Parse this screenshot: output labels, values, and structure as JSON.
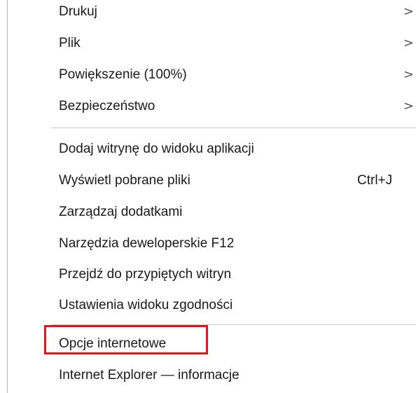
{
  "menu": {
    "items_top": [
      {
        "label": "Drukuj",
        "submenu": true
      },
      {
        "label": "Plik",
        "submenu": true
      },
      {
        "label": "Powiększenie (100%)",
        "submenu": true
      },
      {
        "label": "Bezpieczeństwo",
        "submenu": true
      }
    ],
    "items_mid": [
      {
        "label": "Dodaj witrynę do widoku aplikacji",
        "shortcut": ""
      },
      {
        "label": "Wyświetl pobrane pliki",
        "shortcut": "Ctrl+J"
      },
      {
        "label": "Zarządzaj dodatkami",
        "shortcut": ""
      },
      {
        "label": "Narzędzia deweloperskie F12",
        "shortcut": ""
      },
      {
        "label": "Przejdź do przypiętych witryn",
        "shortcut": ""
      },
      {
        "label": "Ustawienia widoku zgodności",
        "shortcut": ""
      }
    ],
    "items_bottom": [
      {
        "label": "Opcje internetowe",
        "highlighted": true
      },
      {
        "label": "Internet Explorer — informacje"
      }
    ],
    "submenu_arrow": ">",
    "highlight_color": "#e3141c"
  }
}
